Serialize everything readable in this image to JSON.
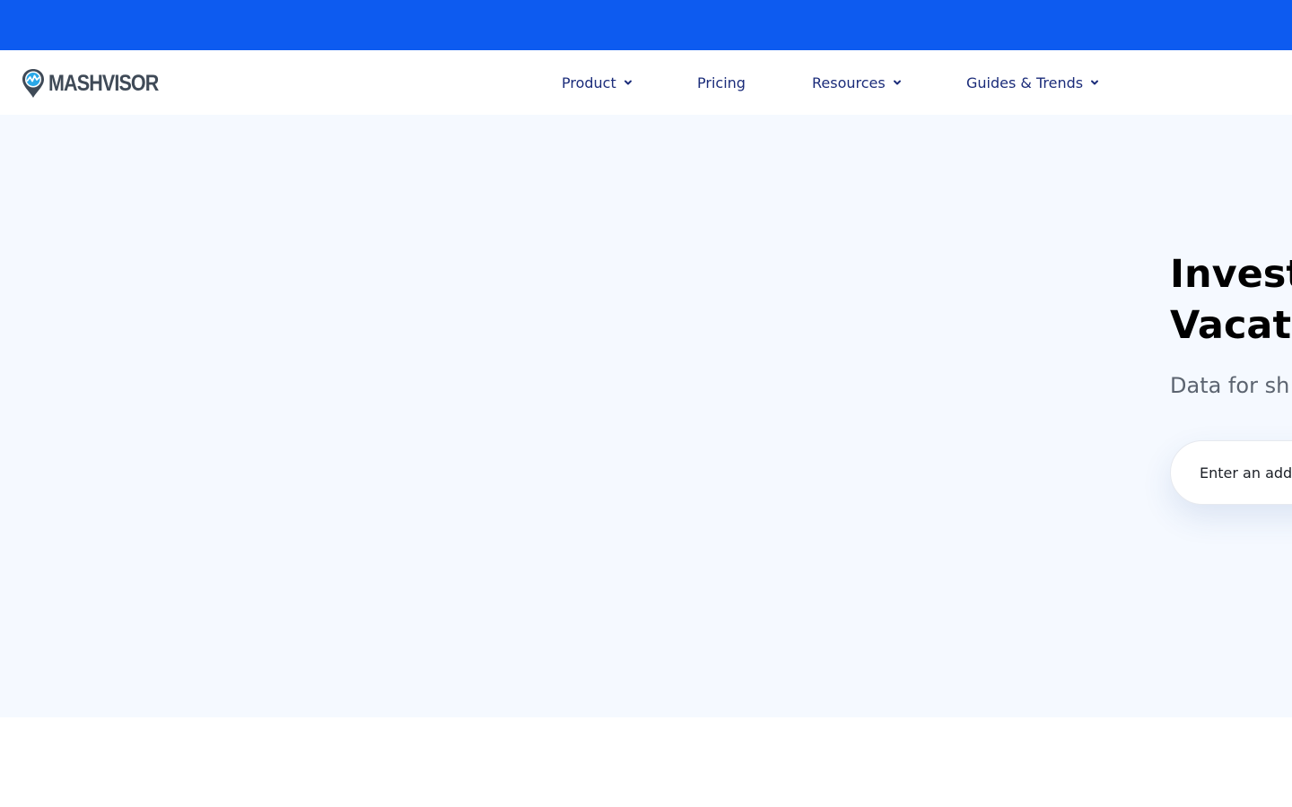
{
  "brand": {
    "name": "MASHVISOR",
    "primary_color": "#0d5bf0",
    "nav_text_color": "#1b2c7a"
  },
  "nav": {
    "items": [
      {
        "label": "Product",
        "has_dropdown": true
      },
      {
        "label": "Pricing",
        "has_dropdown": false
      },
      {
        "label": "Resources",
        "has_dropdown": true
      },
      {
        "label": "Guides & Trends",
        "has_dropdown": true
      }
    ]
  },
  "hero": {
    "title_line1": "Invest",
    "title_line2": "Vacat",
    "subtitle": "Data for sh",
    "search": {
      "placeholder": "Enter an add"
    }
  },
  "icons": {
    "logo": "map-pin-chart-icon",
    "dropdown": "chevron-down-icon"
  }
}
